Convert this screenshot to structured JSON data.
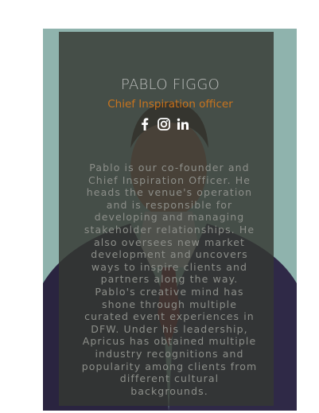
{
  "profile": {
    "name": "PABLO FIGGO",
    "role": "Chief Inspiration officer",
    "bio": "Pablo is our co-founder and Chief Inspiration Officer. He heads the venue's operation and is responsible for developing and managing stakeholder relationships. He also oversees new market development and uncovers ways to inspire clients and partners along the way. Pablo's creative mind has shone through multiple curated event experiences in DFW. Under his leadership, Apricus has obtained multiple industry recognitions and popularity among clients from different cultural backgrounds."
  },
  "social": [
    {
      "icon": "facebook-icon"
    },
    {
      "icon": "instagram-icon"
    },
    {
      "icon": "linkedin-icon"
    }
  ],
  "colors": {
    "card_bg": "#8fb3ad",
    "overlay": "#343832",
    "accent": "#e07b17"
  }
}
